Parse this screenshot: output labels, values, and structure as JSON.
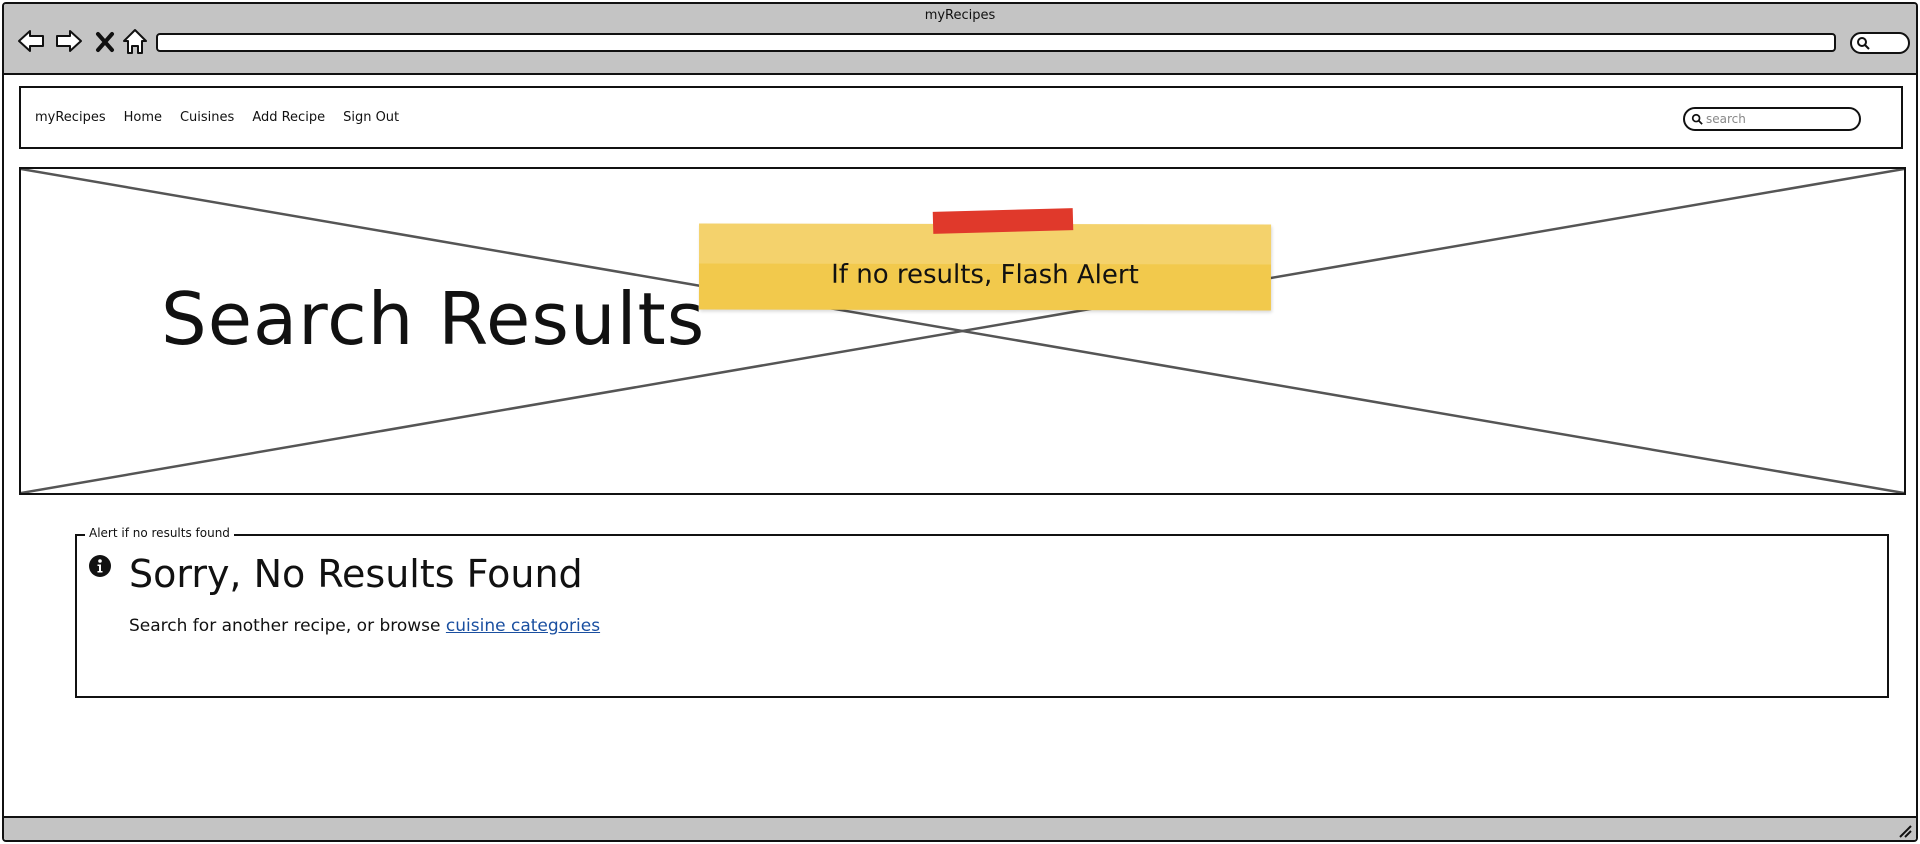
{
  "window": {
    "title": "myRecipes"
  },
  "chrome": {
    "back_icon": "arrow-left-icon",
    "forward_icon": "arrow-right-icon",
    "stop_icon": "close-icon",
    "home_icon": "home-icon",
    "search_icon": "search-icon"
  },
  "navbar": {
    "brand": "myRecipes",
    "links": [
      "Home",
      "Cuisines",
      "Add Recipe",
      "Sign Out"
    ],
    "search_placeholder": "search"
  },
  "hero": {
    "title": "Search Results",
    "sticky_note": "If no results, Flash Alert"
  },
  "alert": {
    "legend": "Alert if no results found",
    "icon": "info-icon",
    "heading": "Sorry, No Results Found",
    "body_text": "Search for another recipe, or browse",
    "link_text": "cuisine categories"
  },
  "colors": {
    "chrome_bg": "#c4c4c4",
    "sticky_note": "#f2c94c",
    "sticky_tape": "#e0392b",
    "link": "#1a4fa0"
  }
}
